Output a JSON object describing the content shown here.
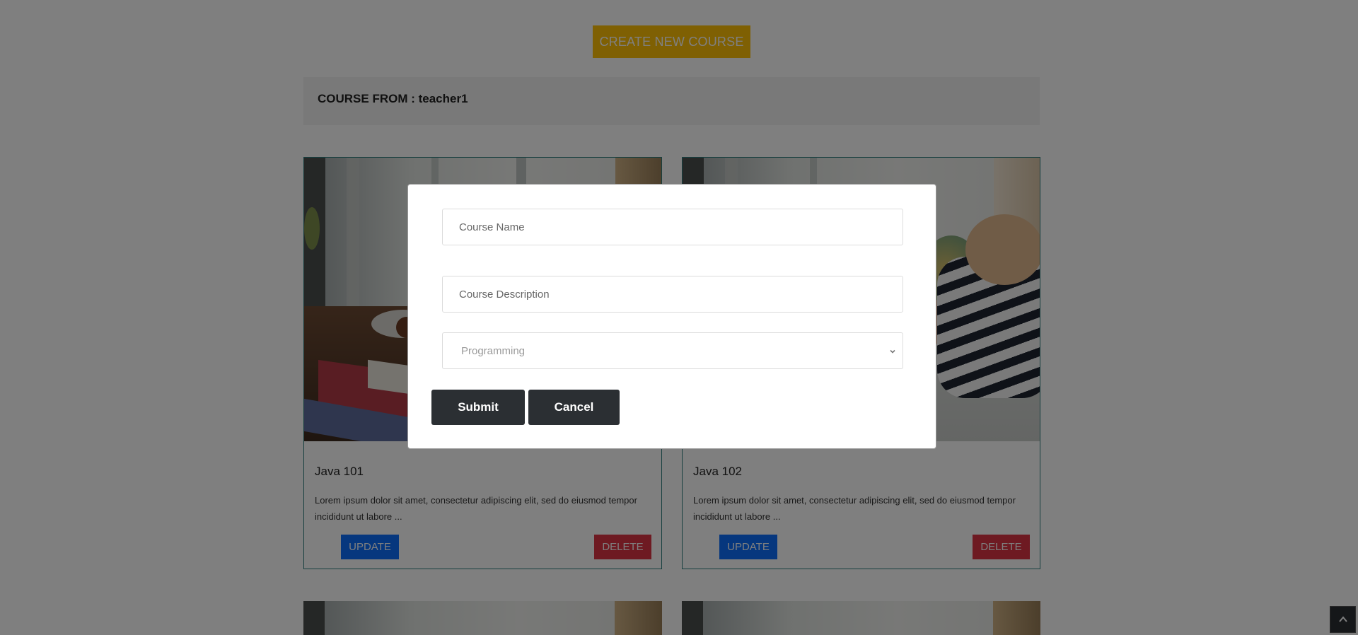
{
  "header": {
    "create_button_label": "CREATE NEW COURSE",
    "teacher_label": "COURSE FROM : teacher1"
  },
  "courses": [
    {
      "title": "Java 101",
      "description": "Lorem ipsum dolor sit amet, consectetur adipiscing elit, sed do eiusmod tempor incididunt ut labore ...",
      "update_label": "UPDATE",
      "delete_label": "DELETE"
    },
    {
      "title": "Java 102",
      "description": "Lorem ipsum dolor sit amet, consectetur adipiscing elit, sed do eiusmod tempor incididunt ut labore ...",
      "update_label": "UPDATE",
      "delete_label": "DELETE"
    }
  ],
  "modal": {
    "course_name_placeholder": "Course Name",
    "course_description_placeholder": "Course Description",
    "category_selected": "Programming",
    "submit_label": "Submit",
    "cancel_label": "Cancel"
  },
  "colors": {
    "accent_yellow": "#ffc107",
    "update_blue": "#0d6efd",
    "delete_red": "#dc3545",
    "dark_button": "#2b2f33"
  },
  "icons": {
    "select_arrow": "chevron-down-icon",
    "scroll_top": "caret-up-icon"
  }
}
